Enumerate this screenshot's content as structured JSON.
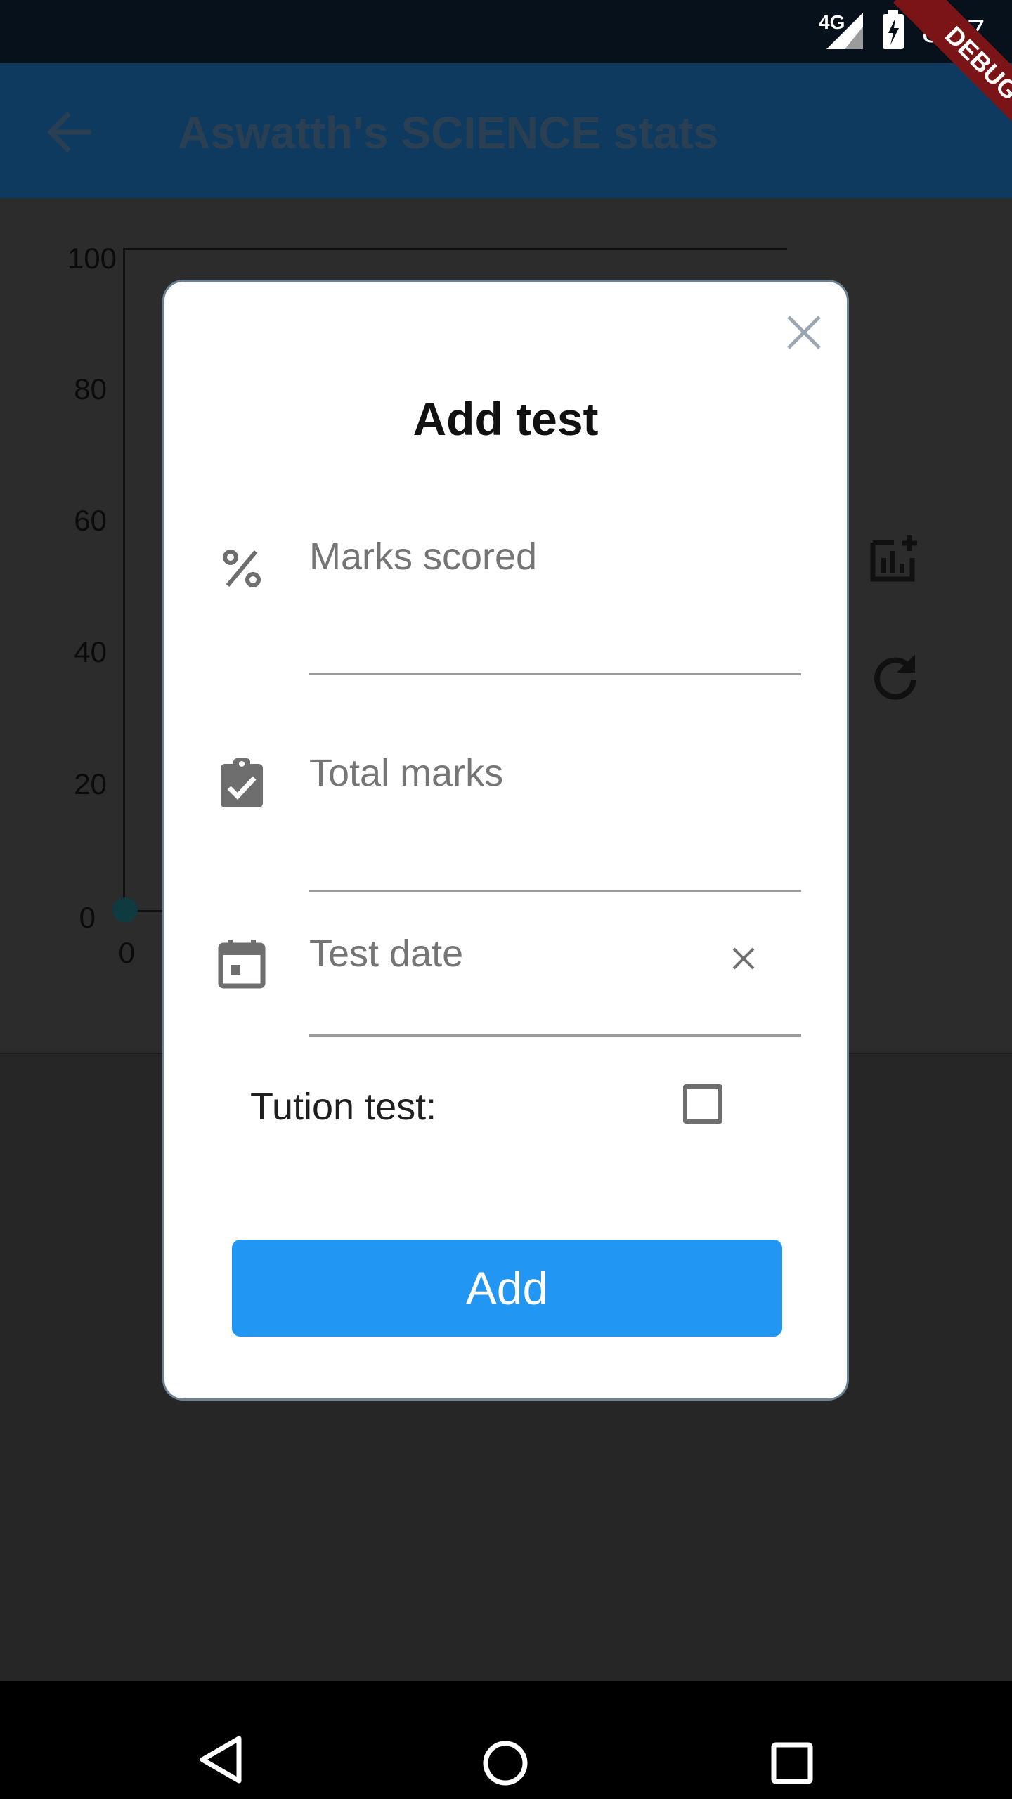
{
  "status_bar": {
    "network": "4G",
    "time": "8:17"
  },
  "app_bar": {
    "title": "Aswatth's SCIENCE stats"
  },
  "chart_data": {
    "type": "line",
    "y_ticks": [
      "100",
      "80",
      "60",
      "40",
      "20",
      "0"
    ],
    "x_ticks": [
      "0"
    ],
    "ylim": [
      0,
      100
    ],
    "points": [
      {
        "x": 0,
        "y": 0
      }
    ]
  },
  "debug_banner": "DEBUG",
  "dialog": {
    "title": "Add test",
    "marks_scored_placeholder": "Marks scored",
    "total_marks_placeholder": "Total marks",
    "test_date_placeholder": "Test date",
    "tution_label": "Tution test:",
    "tution_checked": false,
    "add_label": "Add"
  },
  "icons": {
    "percent": "percent-icon",
    "clipboard": "clipboard-check-icon",
    "calendar": "calendar-icon",
    "close": "close-icon",
    "clear": "clear-icon"
  },
  "colors": {
    "primary": "#2196f3",
    "appbar": "#0e3a60",
    "debug": "#7b1416"
  }
}
